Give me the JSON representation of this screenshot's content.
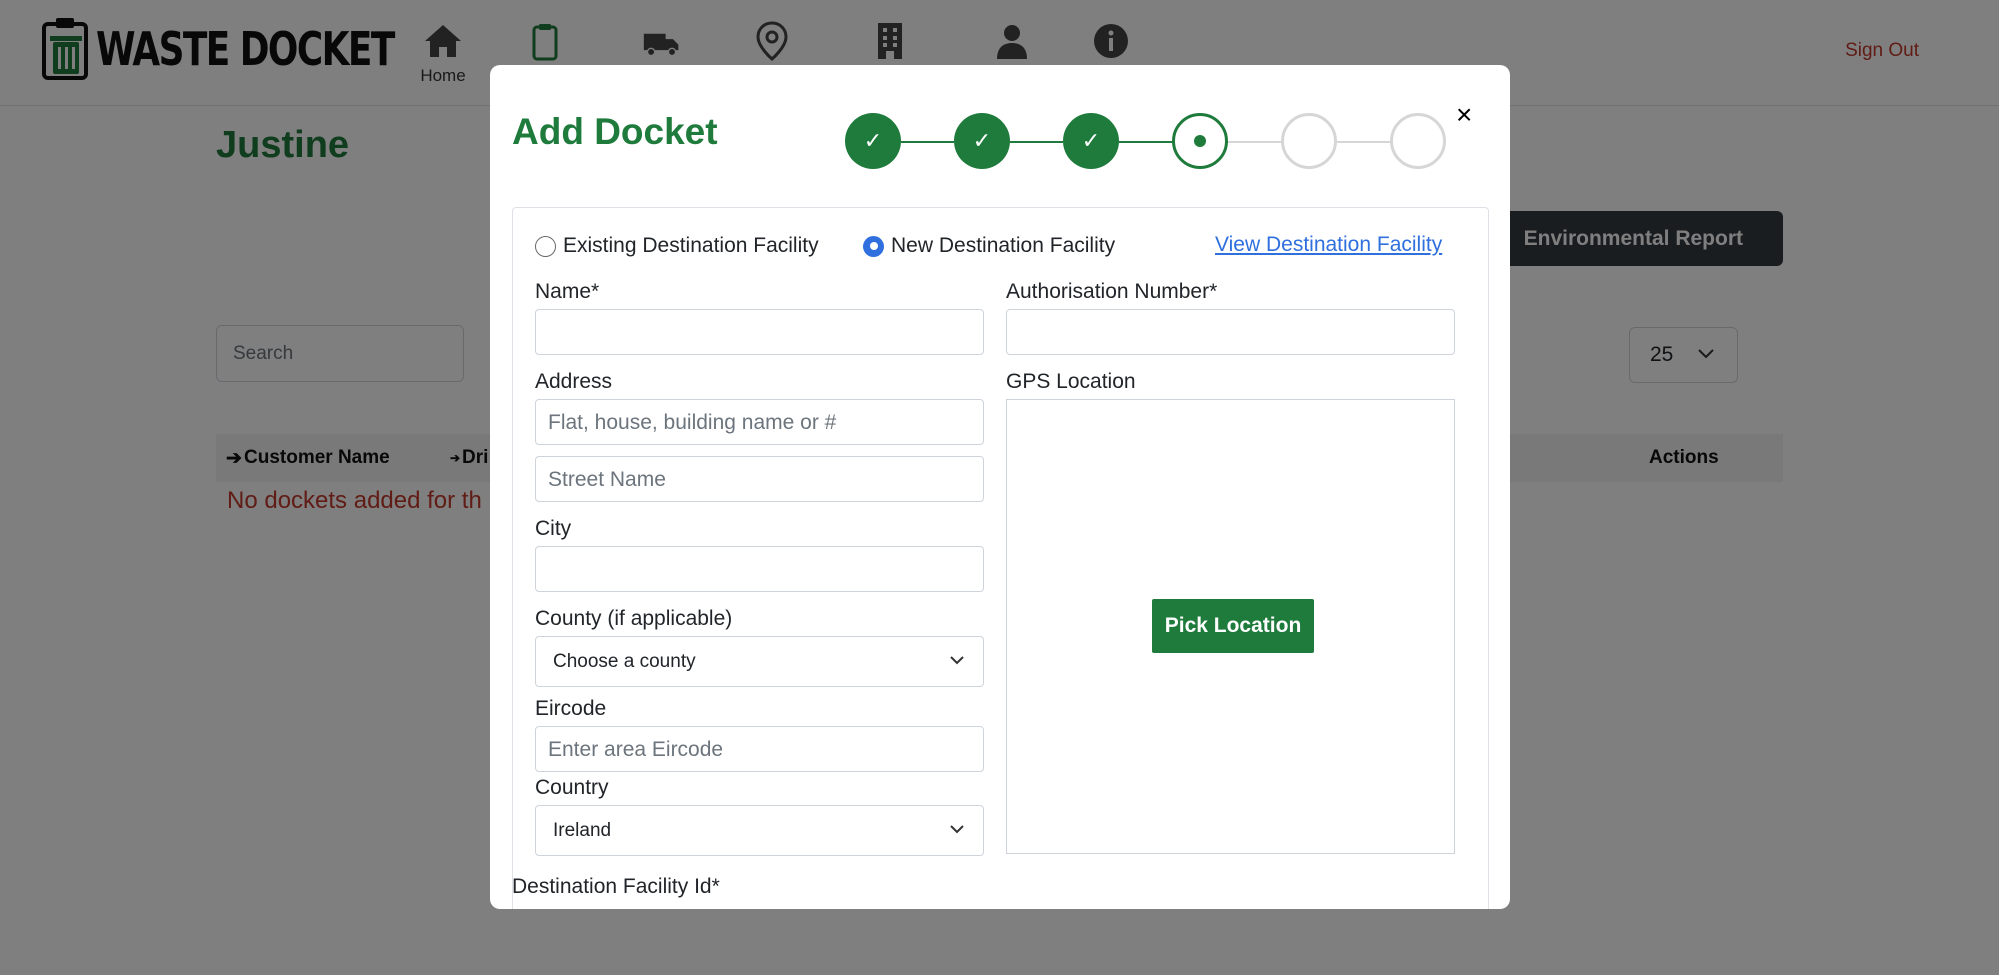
{
  "navbar": {
    "brand": "WASTE DOCKET",
    "items": [
      {
        "icon": "home-icon",
        "label": "Home"
      },
      {
        "icon": "clipboard-icon",
        "label": ""
      },
      {
        "icon": "truck-icon",
        "label": ""
      },
      {
        "icon": "location-pin-icon",
        "label": ""
      },
      {
        "icon": "building-icon",
        "label": ""
      },
      {
        "icon": "user-icon",
        "label": ""
      },
      {
        "icon": "info-icon",
        "label": ""
      }
    ],
    "sign_out": "Sign Out"
  },
  "page": {
    "title": "Justine",
    "report_button": "Environmental Report",
    "search_placeholder": "Search",
    "per_page": "25",
    "columns": {
      "customer_name": "Customer Name",
      "driver_partial": "Dri",
      "actions": "Actions"
    },
    "empty_message": "No dockets added for th"
  },
  "modal": {
    "title": "Add Docket",
    "close": "×",
    "steps": [
      "done",
      "done",
      "done",
      "current",
      "todo",
      "todo"
    ],
    "radio_existing": "Existing Destination Facility",
    "radio_new": "New Destination Facility",
    "view_link": "View Destination Facility",
    "fields": {
      "name_label": "Name*",
      "name_value": "",
      "auth_label": "Authorisation Number*",
      "auth_value": "",
      "address_label": "Address",
      "address1_placeholder": "Flat, house, building name or #",
      "address2_placeholder": "Street Name",
      "city_label": "City",
      "city_value": "",
      "county_label": "County (if applicable)",
      "county_value": "Choose a county",
      "eircode_label": "Eircode",
      "eircode_placeholder": "Enter area Eircode",
      "country_label": "Country",
      "country_value": "Ireland",
      "gps_label": "GPS Location",
      "pick_location": "Pick Location",
      "facility_id_label": "Destination Facility Id*"
    }
  },
  "colors": {
    "brand_green": "#1e7b3c",
    "link_blue": "#2f6fde",
    "danger_red": "#c0392b",
    "dark_button": "#343a40"
  }
}
